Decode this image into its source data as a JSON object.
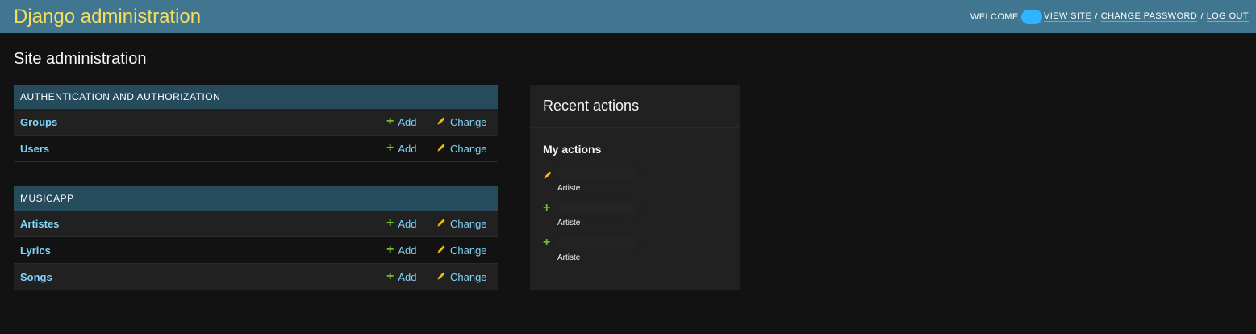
{
  "header": {
    "branding": "Django administration",
    "welcome": "WELCOME,",
    "view_site": "VIEW SITE",
    "change_password": "CHANGE PASSWORD",
    "logout": "LOG OUT",
    "sep": "/"
  },
  "page_title": "Site administration",
  "modules": [
    {
      "caption": "AUTHENTICATION AND AUTHORIZATION",
      "rows": [
        {
          "name": "Groups",
          "add": "Add",
          "change": "Change"
        },
        {
          "name": "Users",
          "add": "Add",
          "change": "Change"
        }
      ]
    },
    {
      "caption": "MUSICAPP",
      "rows": [
        {
          "name": "Artistes",
          "add": "Add",
          "change": "Change"
        },
        {
          "name": "Lyrics",
          "add": "Add",
          "change": "Change"
        },
        {
          "name": "Songs",
          "add": "Add",
          "change": "Change"
        }
      ]
    }
  ],
  "recent": {
    "title": "Recent actions",
    "subtitle": "My actions",
    "items": [
      {
        "icon": "pencil-icon",
        "content_type": "Artiste"
      },
      {
        "icon": "plus-icon",
        "content_type": "Artiste"
      },
      {
        "icon": "plus-icon",
        "content_type": "Artiste"
      }
    ]
  },
  "colors": {
    "header_bg": "#417690",
    "branding": "#f5dd5d",
    "caption_bg": "#264b5d",
    "link": "#81d4fa",
    "add_green": "#70bf2b",
    "change_yellow": "#efb80b",
    "body_bg": "#121212"
  }
}
